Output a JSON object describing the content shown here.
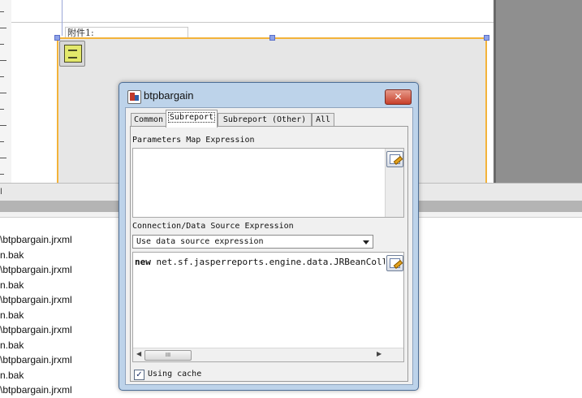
{
  "designer": {
    "field_label": "附件1:"
  },
  "file_list": {
    "top_mark": "l",
    "items": [
      "\\btpbargain.jrxml",
      "n.bak",
      "\\btpbargain.jrxml",
      "n.bak",
      "\\btpbargain.jrxml",
      "n.bak",
      "\\btpbargain.jrxml",
      "n.bak",
      "\\btpbargain.jrxml",
      "n.bak",
      "\\btpbargain.jrxml"
    ]
  },
  "dialog": {
    "title": "btpbargain",
    "close_glyph": "✕",
    "tabs": [
      "Common",
      "Subreport",
      "Subreport (Other)",
      "All"
    ],
    "active_tab": "Subreport",
    "parameters_map_label": "Parameters Map Expression",
    "parameters_map_value": "",
    "connection_label": "Connection/Data Source Expression",
    "connection_select_value": "Use data source expression",
    "expression_keyword": "new",
    "expression_rest": " net.sf.jasperreports.engine.data.JRBeanCollectionDataSource",
    "scroll_thumb_grip": "III",
    "using_cache_label": "Using cache",
    "using_cache_checked": true,
    "check_glyph": "✓"
  },
  "colors": {
    "dialog_frame": "#bdd3ea",
    "selection_border": "#f3b33a",
    "close_button": "#c7402b"
  }
}
